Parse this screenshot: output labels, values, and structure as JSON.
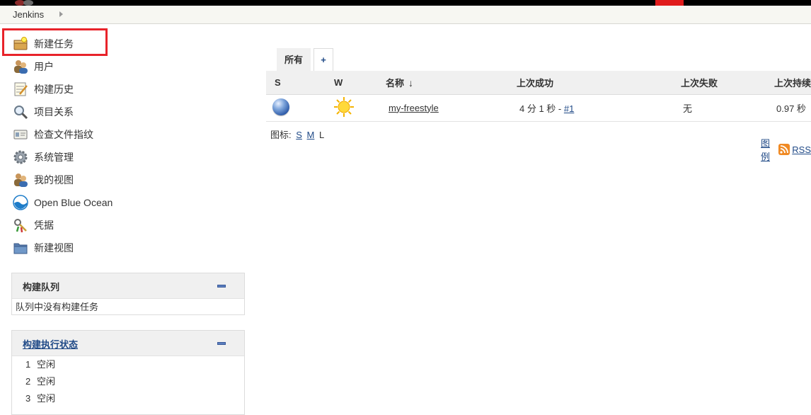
{
  "breadcrumb": {
    "home": "Jenkins"
  },
  "sidebar": {
    "items": [
      {
        "label": "新建任务",
        "icon": "new-item-icon"
      },
      {
        "label": "用户",
        "icon": "users-icon"
      },
      {
        "label": "构建历史",
        "icon": "notepad-icon"
      },
      {
        "label": "项目关系",
        "icon": "search-icon"
      },
      {
        "label": "检查文件指纹",
        "icon": "fingerprint-icon"
      },
      {
        "label": "系统管理",
        "icon": "gear-icon"
      },
      {
        "label": "我的视图",
        "icon": "users-icon"
      },
      {
        "label": "Open Blue Ocean",
        "icon": "blue-ocean-icon"
      },
      {
        "label": "凭据",
        "icon": "keys-icon"
      },
      {
        "label": "新建视图",
        "icon": "folder-icon"
      }
    ]
  },
  "build_queue": {
    "title": "构建队列",
    "empty_text": "队列中没有构建任务"
  },
  "executors": {
    "title": "构建执行状态",
    "rows": [
      {
        "num": "1",
        "status": "空闲"
      },
      {
        "num": "2",
        "status": "空闲"
      },
      {
        "num": "3",
        "status": "空闲"
      }
    ]
  },
  "tabs": {
    "all": "所有",
    "add": "+"
  },
  "table": {
    "headers": {
      "s": "S",
      "w": "W",
      "name": "名称",
      "sort": "↓",
      "last_success": "上次成功",
      "last_failure": "上次失败",
      "last_duration": "上次持续"
    },
    "rows": [
      {
        "name": "my-freestyle",
        "last_success_time": "4 分 1 秒 - ",
        "last_success_build": "#1",
        "last_failure": "无",
        "last_duration": "0.97 秒",
        "status_color": "blue",
        "weather": "sunny"
      }
    ]
  },
  "icon_size": {
    "label": "图标:",
    "s": "S",
    "m": "M",
    "l": "L"
  },
  "footer": {
    "legend": "图例",
    "rss": "RSS"
  },
  "colors": {
    "highlight": "#e8232a",
    "link": "#204a87",
    "header_bg": "#f0f0f0"
  }
}
